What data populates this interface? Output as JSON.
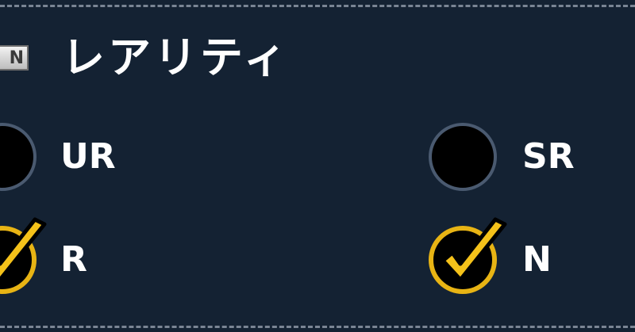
{
  "section": {
    "title": "レアリティ",
    "badge_text": "N"
  },
  "options": {
    "ur": {
      "label": "UR",
      "checked": false
    },
    "sr": {
      "label": "SR",
      "checked": false
    },
    "r": {
      "label": "R",
      "checked": true
    },
    "n": {
      "label": "N",
      "checked": true
    }
  },
  "colors": {
    "background": "#142233",
    "check_gold": "#e8b414",
    "radio_border": "#4a5a70",
    "divider": "#7a8594"
  },
  "icons": {
    "badge": "rarity-n-badge-icon",
    "check": "checkmark-icon"
  }
}
